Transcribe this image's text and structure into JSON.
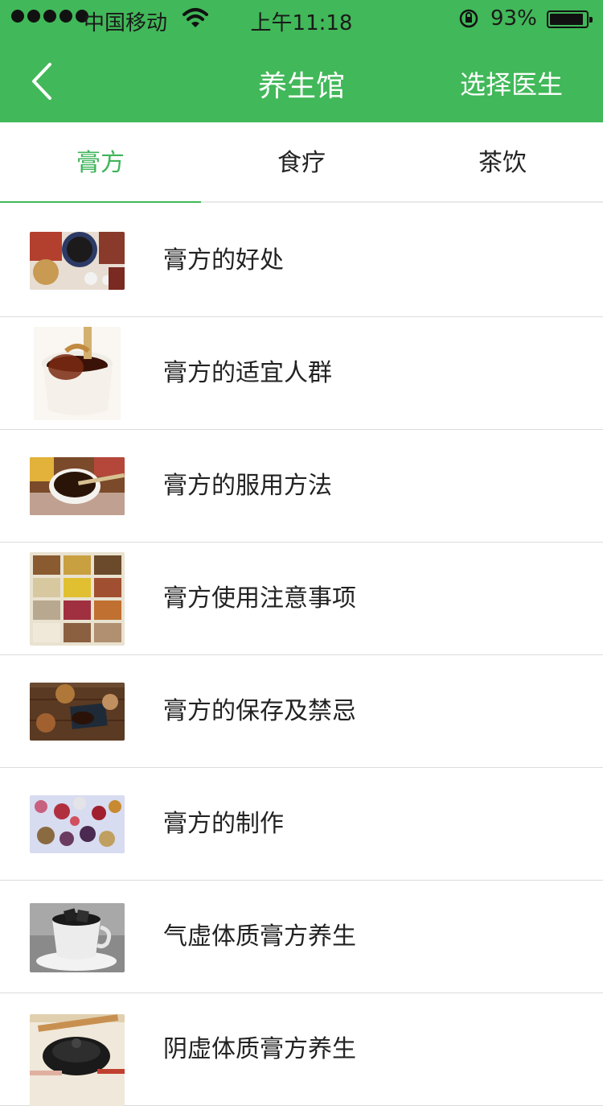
{
  "status": {
    "carrier": "中国移动",
    "time": "上午11:18",
    "battery": "93%",
    "battery_level": 0.93
  },
  "nav": {
    "title": "养生馆",
    "right_button": "选择医生"
  },
  "tabs": [
    {
      "label": "膏方",
      "active": true
    },
    {
      "label": "食疗",
      "active": false
    },
    {
      "label": "茶饮",
      "active": false
    }
  ],
  "items": [
    {
      "label": "膏方的好处"
    },
    {
      "label": "膏方的适宜人群"
    },
    {
      "label": "膏方的服用方法"
    },
    {
      "label": "膏方使用注意事项"
    },
    {
      "label": "膏方的保存及禁忌"
    },
    {
      "label": "膏方的制作"
    },
    {
      "label": "气虚体质膏方养生"
    },
    {
      "label": "阴虚体质膏方养生"
    }
  ],
  "colors": {
    "primary": "#41b859",
    "active_tab": "#3fb45a"
  }
}
